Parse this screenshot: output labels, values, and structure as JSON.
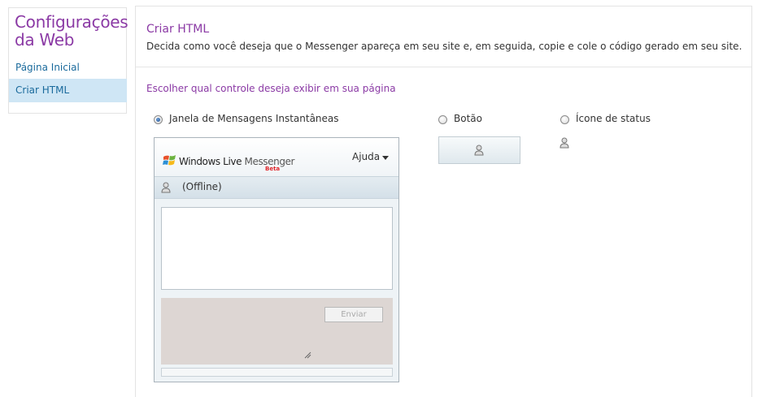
{
  "sidebar": {
    "title_line1": "Configurações",
    "title_line2": "da Web",
    "items": [
      {
        "label": "Página Inicial"
      },
      {
        "label": "Criar HTML"
      }
    ]
  },
  "main": {
    "title": "Criar HTML",
    "description": "Decida como você deseja que o Messenger apareça em seu site e, em seguida, copie e cole o código gerado em seu site.",
    "section_heading": "Escolher qual controle deseja exibir em sua página",
    "options": [
      {
        "label": "Janela de Mensagens Instantâneas",
        "selected": true
      },
      {
        "label": "Botão",
        "selected": false
      },
      {
        "label": "Ícone de status",
        "selected": false
      }
    ]
  },
  "messenger": {
    "logo_windows_live": "Windows Live",
    "logo_messenger": " Messenger",
    "logo_beta": "Beta",
    "help_label": "Ajuda",
    "status_text": "(Offline)",
    "send_label": "Enviar"
  },
  "colors": {
    "accent_purple": "#8b3aa5",
    "link_blue": "#1a6a9c",
    "active_item_bg": "#cfe6f5"
  }
}
